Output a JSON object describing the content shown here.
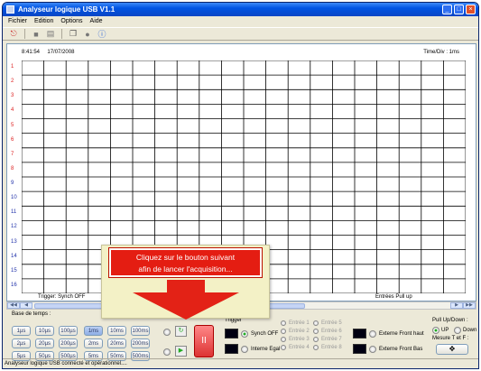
{
  "window": {
    "title": "Analyseur logique USB V1.1"
  },
  "menu": [
    "Fichier",
    "Edition",
    "Options",
    "Aide"
  ],
  "toolbar": {
    "icons": [
      "exit-icon",
      "stop-icon",
      "print-icon",
      "copy-icon",
      "record-icon",
      "info-icon"
    ]
  },
  "plot": {
    "time": "8:41:54",
    "date": "17/07/2008",
    "time_div": "Time/Div : 1ms",
    "rows": [
      "1",
      "2",
      "3",
      "4",
      "5",
      "6",
      "7",
      "8",
      "9",
      "10",
      "11",
      "12",
      "13",
      "14",
      "15",
      "16"
    ],
    "trigger_text": "Trigger: Synch OFF",
    "pullup_text": "Entrées Pull up"
  },
  "controls": {
    "base_label": "Base de temps :",
    "time_buttons": [
      "1µs",
      "10µs",
      "100µs",
      "1ms",
      "10ms",
      "100ms",
      "2µs",
      "20µs",
      "200µs",
      "2ms",
      "20ms",
      "200ms",
      "5µs",
      "50µs",
      "500µs",
      "5ms",
      "50ms",
      "500ms"
    ],
    "selected_time": "1ms",
    "trigger_label": "Trigger",
    "synch_off": "Synch OFF",
    "interne_egal": "Interne Egal",
    "entrees": [
      "Entrée 1",
      "Entrée 5",
      "Entrée 2",
      "Entrée 6",
      "Entrée 3",
      "Entrée 7",
      "Entrée 4",
      "Entrée 8"
    ],
    "ext_haut": "Externe Front haut",
    "ext_bas": "Externe Front Bas",
    "pull_label": "Pull Up/Down :",
    "pull_up": "UP",
    "pull_down": "Down",
    "mesure": "Mesure T et F :"
  },
  "callout": {
    "line1": "Cliquez sur le bouton suivant",
    "line2": "afin de lancer l'acquisition..."
  },
  "status": "Analyseur logique USB connecté et opérationnel...."
}
